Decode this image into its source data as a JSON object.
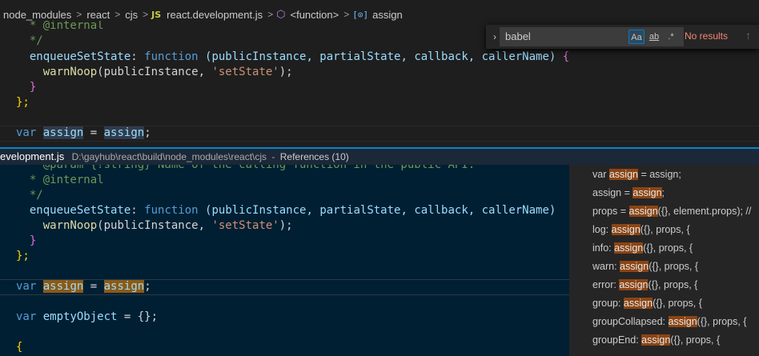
{
  "breadcrumb": {
    "items": [
      "node_modules",
      "react",
      "cjs"
    ],
    "js_badge": "JS",
    "file": "react.development.js",
    "function": "<function>",
    "symbol": "assign",
    "separator": ">"
  },
  "editor": {
    "lines": [
      {
        "pre": "  * ",
        "tag": "@internal"
      },
      {
        "text": "  */"
      },
      {
        "prop": "enqueueSetState",
        "rest": " (publicInstance, partialState, callback, callerName) "
      },
      {
        "call": "warnNoop",
        "args": "(publicInstance, ",
        "str": "'setState'",
        "end": ");"
      },
      {
        "close": "}"
      },
      {
        "close": "};"
      },
      {
        "kw": "var",
        "name": "assign",
        "eq": " = ",
        "val": "assign",
        "semi": ";"
      }
    ]
  },
  "find": {
    "query": "babel",
    "match_case": "Aa",
    "whole_word": "ab",
    "regex": ".*",
    "status": "No results",
    "toggle": "›",
    "up": "↑"
  },
  "peek": {
    "file": "evelopment.js",
    "path": "D:\\gayhub\\react\\build\\node_modules\\react\\cjs",
    "separator": "-",
    "count": "References (10)",
    "code": {
      "param_line": "  * @param {?string} Name of the calling function in the public API.",
      "internal_pre": "  * ",
      "internal_tag": "@internal",
      "close_comment": "  */",
      "prop": "enqueueSetState",
      "fn_kw": "function",
      "params": "(publicInstance, partialState, callback, callerName)",
      "call": "warnNoop",
      "args": "(publicInstance, ",
      "str": "'setState'",
      "end": ");",
      "brace": "}",
      "brace_semi": "};",
      "var_kw": "var",
      "assign_a": "assign",
      "eq": " = ",
      "assign_b": "assign",
      "semi": ";",
      "empty_name": "emptyObject",
      "empty_rest": " = {};",
      "open_brace": "{"
    },
    "references": [
      {
        "pre": "var ",
        "match": "assign",
        "post": " = assign;"
      },
      {
        "pre": "assign = ",
        "match": "assign",
        "post": ";"
      },
      {
        "pre": "props = ",
        "match": "assign",
        "post": "({}, element.props); //"
      },
      {
        "pre": "log: ",
        "match": "assign",
        "post": "({}, props, {"
      },
      {
        "pre": "info: ",
        "match": "assign",
        "post": "({}, props, {"
      },
      {
        "pre": "warn: ",
        "match": "assign",
        "post": "({}, props, {"
      },
      {
        "pre": "error: ",
        "match": "assign",
        "post": "({}, props, {"
      },
      {
        "pre": "group: ",
        "match": "assign",
        "post": "({}, props, {"
      },
      {
        "pre": "groupCollapsed: ",
        "match": "assign",
        "post": "({}, props, {"
      },
      {
        "pre": "groupEnd: ",
        "match": "assign",
        "post": "({}, props, {"
      }
    ]
  },
  "keywords": {
    "function": "function"
  }
}
